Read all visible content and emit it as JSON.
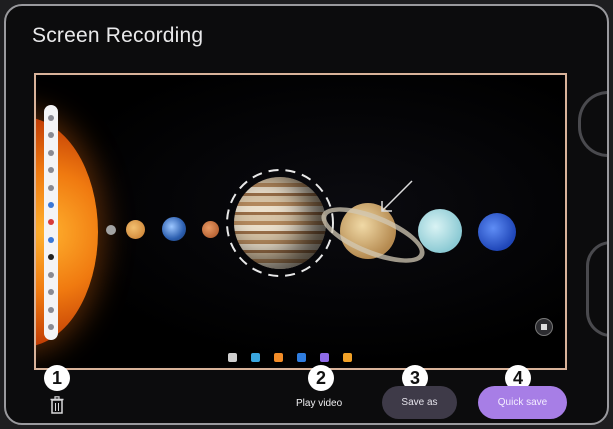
{
  "window": {
    "title": "Screen Recording"
  },
  "callouts": [
    "1",
    "2",
    "3",
    "4"
  ],
  "actions": {
    "play_video": "Play video",
    "save_as": "Save as",
    "quick_save": "Quick save"
  },
  "icons": {
    "delete": "trash-icon",
    "maximize": "maximize-icon"
  },
  "colors": {
    "quick_save_bg": "#a77ee6",
    "save_as_bg": "#3e3a48",
    "preview_border": "#d9b39a"
  }
}
